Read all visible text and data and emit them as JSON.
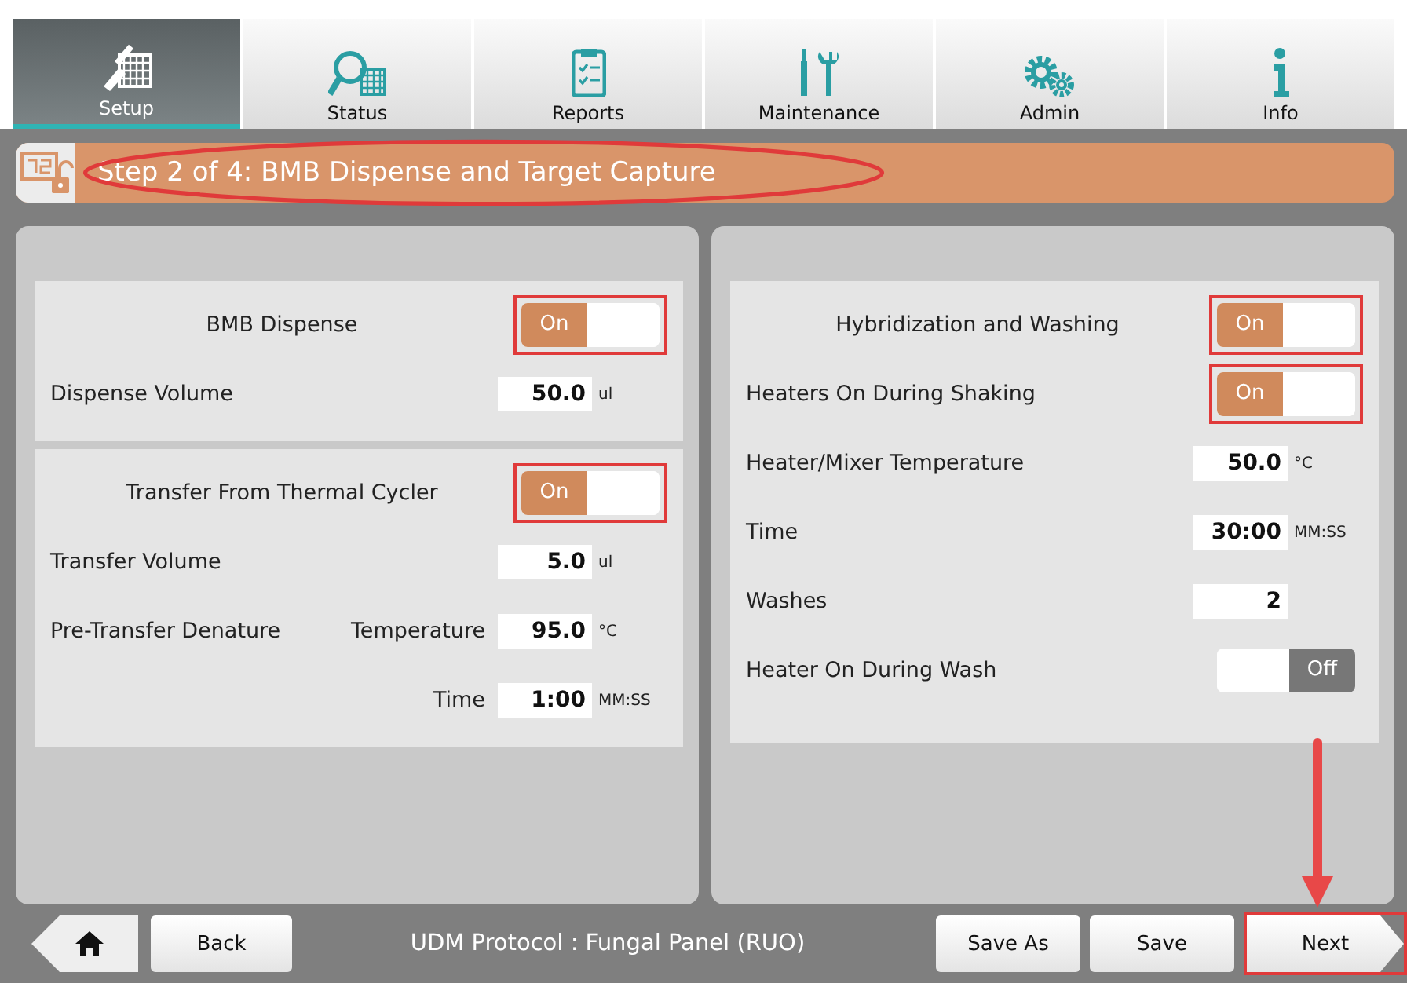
{
  "tabs": [
    {
      "label": "Setup",
      "selected": true
    },
    {
      "label": "Status",
      "selected": false
    },
    {
      "label": "Reports",
      "selected": false
    },
    {
      "label": "Maintenance",
      "selected": false
    },
    {
      "label": "Admin",
      "selected": false
    },
    {
      "label": "Info",
      "selected": false
    }
  ],
  "step_header": {
    "title": "Step 2 of 4: BMB Dispense and Target Capture",
    "circled": true
  },
  "panels": [
    {
      "sections": [
        {
          "rows": [
            {
              "kind": "toggle",
              "label": "BMB Dispense",
              "centered": true,
              "state_text": "On",
              "on": true,
              "highlighted": true
            },
            {
              "kind": "field",
              "label": "Dispense Volume",
              "value": "50.0",
              "unit": "ul"
            }
          ]
        },
        {
          "rows": [
            {
              "kind": "toggle",
              "label": "Transfer From Thermal Cycler",
              "centered": true,
              "state_text": "On",
              "on": true,
              "highlighted": true
            },
            {
              "kind": "field",
              "label": "Transfer Volume",
              "value": "5.0",
              "unit": "ul"
            },
            {
              "kind": "field",
              "label": "Pre-Transfer Denature",
              "sublabel": "Temperature",
              "value": "95.0",
              "unit": "°C"
            },
            {
              "kind": "field",
              "sublabel": "Time",
              "value": "1:00",
              "unit": "MM:SS"
            }
          ]
        }
      ]
    },
    {
      "sections": [
        {
          "rows": [
            {
              "kind": "toggle",
              "label": "Hybridization and Washing",
              "centered": true,
              "state_text": "On",
              "on": true,
              "highlighted": true
            },
            {
              "kind": "toggle",
              "label": "Heaters On During Shaking",
              "centered": false,
              "state_text": "On",
              "on": true,
              "highlighted": true
            },
            {
              "kind": "field",
              "label": "Heater/Mixer Temperature",
              "value": "50.0",
              "unit": "°C"
            },
            {
              "kind": "field",
              "label": "Time",
              "value": "30:00",
              "unit": "MM:SS"
            },
            {
              "kind": "field",
              "label": "Washes",
              "value": "2"
            },
            {
              "kind": "toggle",
              "label": "Heater On During Wash",
              "centered": false,
              "state_text": "Off",
              "on": false,
              "highlighted": false
            }
          ]
        }
      ]
    }
  ],
  "footer": {
    "back": "Back",
    "protocol": "UDM Protocol : Fungal Panel (RUO)",
    "save_as": "Save As",
    "save": "Save",
    "next": "Next",
    "next_highlighted": true
  }
}
